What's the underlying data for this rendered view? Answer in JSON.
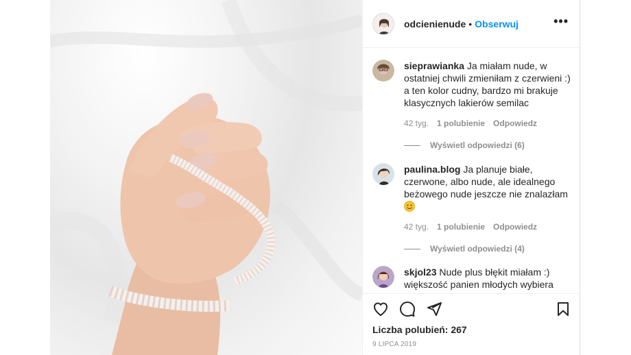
{
  "post": {
    "author": "odcienienude",
    "separator": "•",
    "follow_label": "Obserwuj",
    "more_label": "•••"
  },
  "comments": [
    {
      "user": "sieprawianka",
      "text": "Ja miałam nude, w ostatniej chwili zmieniłam z czerwieni :) a ten kolor cudny, bardzo mi brakuje klasycznych lakierów semilac",
      "age": "42 tyg.",
      "likes": "1 polubienie",
      "reply_label": "Odpowiedz",
      "view_replies": "Wyświetl odpowiedzi (6)"
    },
    {
      "user": "paulina.blog",
      "text": "Ja planuje białe, czerwone, albo nude, ale idealnego beżowego nude jeszcze nie znalazłam",
      "emoji_icon": "smiling-face-emoji",
      "age": "42 tyg.",
      "likes": "1 polubienie",
      "reply_label": "Odpowiedz",
      "view_replies": "Wyświetl odpowiedzi (4)"
    },
    {
      "user": "skjol23",
      "text": "Nude plus błękit miałam :) większość panien młodych wybiera"
    }
  ],
  "actions": {
    "icons": [
      "heart-icon",
      "comment-icon",
      "share-icon",
      "bookmark-icon"
    ],
    "likes_text": "Liczba polubień: 267",
    "date": "9 LIPCA 2019"
  },
  "colors": {
    "accent": "#0095f6",
    "text": "#262626",
    "muted": "#8e8e8e",
    "divider": "#efefef",
    "nail": "#ecc9bf",
    "skin": "#eec4ab"
  }
}
